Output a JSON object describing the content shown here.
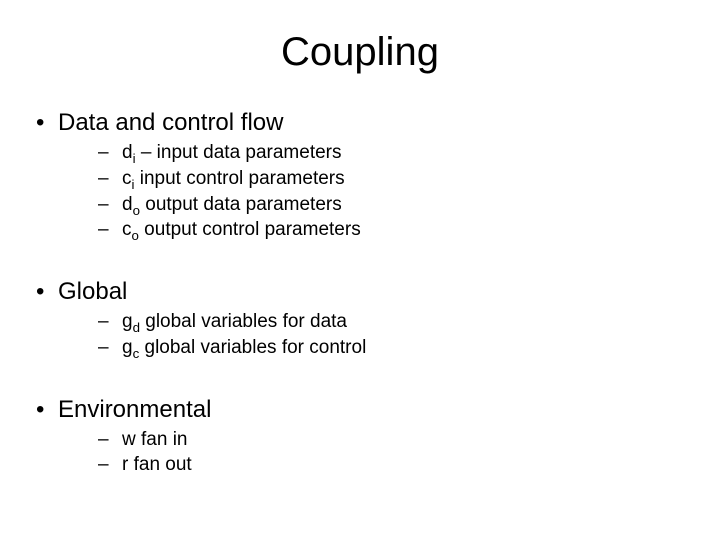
{
  "title": "Coupling",
  "sections": [
    {
      "heading": "Data and control flow",
      "items": [
        {
          "sym": "d",
          "sub": "i",
          "text": " – input data parameters"
        },
        {
          "sym": "c",
          "sub": "i",
          "text": " input control parameters"
        },
        {
          "sym": "d",
          "sub": "o",
          "text": " output data parameters"
        },
        {
          "sym": "c",
          "sub": "o",
          "text": " output control parameters"
        }
      ]
    },
    {
      "heading": "Global",
      "items": [
        {
          "sym": "g",
          "sub": "d",
          "text": " global variables for data"
        },
        {
          "sym": "g",
          "sub": "c",
          "text": " global variables for control"
        }
      ]
    },
    {
      "heading": "Environmental",
      "items": [
        {
          "sym": "w",
          "sub": "",
          "text": " fan in"
        },
        {
          "sym": "r",
          "sub": "",
          "text": " fan out"
        }
      ]
    }
  ]
}
